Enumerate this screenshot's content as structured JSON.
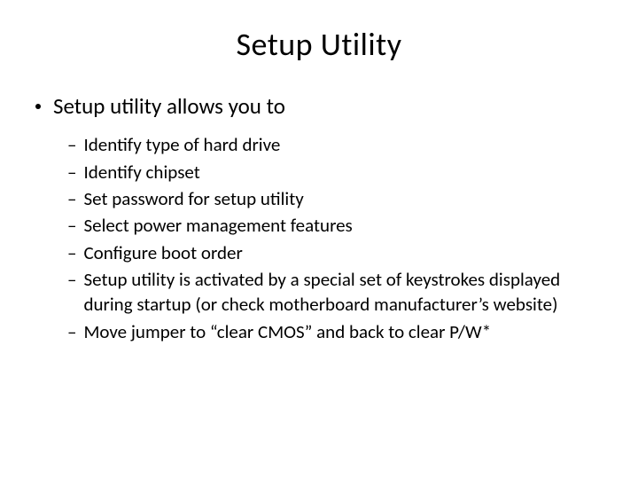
{
  "title": "Setup Utility",
  "main_bullet": "Setup utility allows you to",
  "sub_items": [
    "Identify type of hard drive",
    "Identify chipset",
    "Set password for setup utility",
    "Select power management features",
    "Configure boot order",
    "Setup utility is activated by a special set of keystrokes displayed during startup (or check motherboard manufacturer’s website)",
    "Move jumper to “clear CMOS” and back to clear P/W*"
  ]
}
